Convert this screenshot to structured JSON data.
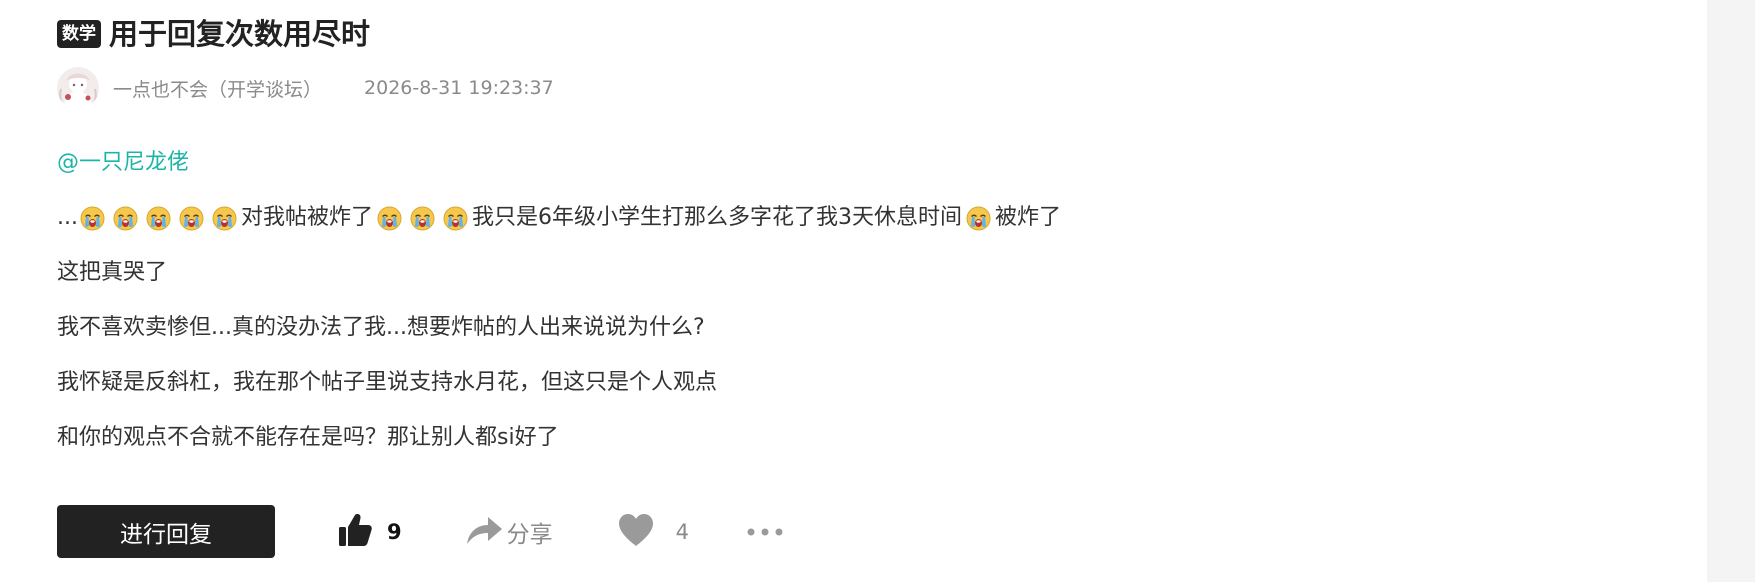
{
  "post": {
    "category": "数学",
    "title": "用于回复次数用尽时"
  },
  "meta": {
    "author": "一点也不会（开学谈坛）",
    "timestamp": "2026-8-31 19:23:37"
  },
  "body": {
    "mention": "@一只尼龙佬",
    "line1": {
      "prefix": "...",
      "text_a": "对我帖被炸了",
      "text_b": "我只是6年级小学生打那么多字花了我3天休息时间",
      "text_c": "被炸了"
    },
    "line2": "这把真哭了",
    "line3": "我不喜欢卖惨但...真的没办法了我...想要炸帖的人出来说说为什么?",
    "line4": "我怀疑是反斜杠，我在那个帖子里说支持水月花，但这只是个人观点",
    "line5": "和你的观点不合就不能存在是吗？那让别人都si好了",
    "emoji": "crying-face-emoji"
  },
  "actions": {
    "reply_label": "进行回复",
    "like_count": "9",
    "share_label": "分享",
    "favorite_count": "4"
  },
  "colors": {
    "mention": "#1bb5a8",
    "reply_button_bg": "#222222",
    "muted_text": "#8a8a8a"
  }
}
